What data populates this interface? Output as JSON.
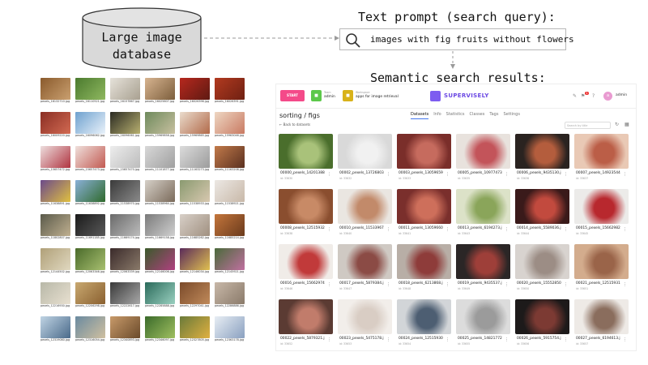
{
  "database": {
    "line1": "Large image",
    "line2": "database"
  },
  "prompt": {
    "title": "Text prompt (search query):",
    "query": "images with fig fruits without flowers"
  },
  "results_title": "Semantic search results:",
  "app": {
    "start": "START",
    "team_label": "Team",
    "team_name": "admin",
    "workspace_label": "Workspace",
    "workspace_name": "apps for image retrieval",
    "logo": "SUPERVISELY",
    "user": "admin",
    "user_initial": "a",
    "notification_count": "1",
    "breadcrumb": "sorting / figs",
    "back": "← Back to datasets",
    "tabs": [
      "Datasets",
      "Info",
      "Statistics",
      "Classes",
      "Tags",
      "Settings"
    ],
    "filter_placeholder": "Search by title",
    "cards": [
      {
        "name": "00000_pexels_14201388",
        "id": "id: 33630",
        "colors": [
          "#4a6e2c",
          "#a9c27a"
        ]
      },
      {
        "name": "00002_pexels_13726803",
        "id": "id: 33632",
        "colors": [
          "#d9d9d9",
          "#f1f1f1"
        ]
      },
      {
        "name": "00003_pexels_13059659",
        "id": "id: 33633",
        "colors": [
          "#7a2e2a",
          "#c66b5e"
        ]
      },
      {
        "name": "00005_pexels_10977473",
        "id": "id: 33635",
        "colors": [
          "#e8e2dd",
          "#c3545a"
        ]
      },
      {
        "name": "00006_pexels_9435130.j",
        "id": "id: 33636",
        "colors": [
          "#2a2320",
          "#b45d3d"
        ]
      },
      {
        "name": "00007_pexels_14923544",
        "id": "id: 33637",
        "colors": [
          "#e9c9b5",
          "#bb5e47"
        ]
      },
      {
        "name": "00008_pexels_12515932",
        "id": "id: 33638",
        "colors": [
          "#8a4e2f",
          "#c88a66"
        ]
      },
      {
        "name": "00010_pexels_11533967",
        "id": "id: 33640",
        "colors": [
          "#eae6e1",
          "#c28a6a"
        ]
      },
      {
        "name": "00011_pexels_13059660",
        "id": "id: 33641",
        "colors": [
          "#7a2f2c",
          "#ce6f5b"
        ]
      },
      {
        "name": "00013_pexels_6194273.j",
        "id": "id: 33643",
        "colors": [
          "#dce2c8",
          "#8aa55a"
        ]
      },
      {
        "name": "00014_pexels_5589036.j",
        "id": "id: 33644",
        "colors": [
          "#3a1a1a",
          "#c24a3e"
        ]
      },
      {
        "name": "00015_pexels_15662982",
        "id": "id: 33645",
        "colors": [
          "#ecebe9",
          "#b8282e"
        ]
      },
      {
        "name": "00016_pexels_15662974",
        "id": "id: 33646",
        "colors": [
          "#f0ece8",
          "#c13a3a"
        ]
      },
      {
        "name": "00017_pexels_5879384.j",
        "id": "id: 33647",
        "colors": [
          "#cfc9c3",
          "#8b4b45"
        ]
      },
      {
        "name": "00018_pexels_6213868.j",
        "id": "id: 33648",
        "colors": [
          "#b8aea6",
          "#8e3c3a"
        ]
      },
      {
        "name": "00019_pexels_9435537.j",
        "id": "id: 33649",
        "colors": [
          "#2b2626",
          "#9e3f39"
        ]
      },
      {
        "name": "00020_pexels_15552850",
        "id": "id: 33650",
        "colors": [
          "#d8d3cf",
          "#9c8d85"
        ]
      },
      {
        "name": "00021_pexels_12515931",
        "id": "id: 33651",
        "colors": [
          "#d3ac8d",
          "#9a6449"
        ]
      },
      {
        "name": "00022_pexels_5879321.j",
        "id": "id: 33652",
        "colors": [
          "#5b3b33",
          "#c17c6b"
        ]
      },
      {
        "name": "00023_pexels_5475178.j",
        "id": "id: 33653",
        "colors": [
          "#f2eeea",
          "#d9cdc4"
        ]
      },
      {
        "name": "00024_pexels_12515930",
        "id": "id: 33654",
        "colors": [
          "#d2d5d8",
          "#4d5e72"
        ]
      },
      {
        "name": "00025_pexels_14821772",
        "id": "id: 33655",
        "colors": [
          "#dcdcdc",
          "#9b9b9b"
        ]
      },
      {
        "name": "00026_pexels_5915754.j",
        "id": "id: 33656",
        "colors": [
          "#1d1a1a",
          "#7c3a33"
        ]
      },
      {
        "name": "00027_pexels_6194613.j",
        "id": "id: 33657",
        "colors": [
          "#eeeae6",
          "#8a6d5d"
        ]
      }
    ]
  },
  "left_grid": [
    {
      "cap": "pexels_16132710.jpg",
      "c": [
        "#8a5a2c",
        "#caa070"
      ]
    },
    {
      "cap": "pexels_16110521.jpg",
      "c": [
        "#4b7a2e",
        "#8fb860"
      ]
    },
    {
      "cap": "pexels_16157867.jpg",
      "c": [
        "#e6e2da",
        "#a8a090"
      ]
    },
    {
      "cap": "pexels_16025607.jpg",
      "c": [
        "#d7b490",
        "#7c5e3c"
      ]
    },
    {
      "cap": "pexels_16026396.jpg",
      "c": [
        "#b6281e",
        "#5e1a12"
      ]
    },
    {
      "cap": "pexels_16026391.jpg",
      "c": [
        "#b23a20",
        "#6e2012"
      ]
    },
    {
      "cap": "pexels_16009220.jpg",
      "c": [
        "#8a2e24",
        "#d26a52"
      ]
    },
    {
      "cap": "pexels_16096062.jpg",
      "c": [
        "#6ea1cf",
        "#eaf2fa"
      ]
    },
    {
      "cap": "pexels_16096061.jpg",
      "c": [
        "#2a2a22",
        "#b8b070"
      ]
    },
    {
      "cap": "pexels_15969858.jpg",
      "c": [
        "#6e8a5c",
        "#c8c0a0"
      ]
    },
    {
      "cap": "pexels_15969865.jpg",
      "c": [
        "#eadccd",
        "#b26a4a"
      ]
    },
    {
      "cap": "pexels_15963046.jpg",
      "c": [
        "#eed7c3",
        "#c97a62"
      ]
    },
    {
      "cap": "pexels_15657472.jpg",
      "c": [
        "#eddede",
        "#b03440"
      ]
    },
    {
      "cap": "pexels_15657473.jpg",
      "c": [
        "#efe0dc",
        "#c25a52"
      ]
    },
    {
      "cap": "pexels_15657470.jpg",
      "c": [
        "#ededed",
        "#bcbcbc"
      ]
    },
    {
      "cap": "pexels_11101877.jpg",
      "c": [
        "#d8d8d8",
        "#a0a0a0"
      ]
    },
    {
      "cap": "pexels_11163273.jpg",
      "c": [
        "#dcdcdc",
        "#9c9c9c"
      ]
    },
    {
      "cap": "pexels_11163208.jpg",
      "c": [
        "#c27a4a",
        "#5a3020"
      ]
    },
    {
      "cap": "pexels_11638891.jpg",
      "c": [
        "#6c4a8a",
        "#e0c040"
      ]
    },
    {
      "cap": "pexels_11638892.jpg",
      "c": [
        "#8ab0d8",
        "#2f6a2c"
      ]
    },
    {
      "cap": "pexels_11538970.jpg",
      "c": [
        "#3a3a3a",
        "#8a8a8a"
      ]
    },
    {
      "cap": "pexels_11538964.jpg",
      "c": [
        "#d6d0c8",
        "#7a6a5a"
      ]
    },
    {
      "cap": "pexels_11538933.jpg",
      "c": [
        "#8a9a70",
        "#d8c8b0"
      ]
    },
    {
      "cap": "pexels_11538921.jpg",
      "c": [
        "#ece8e4",
        "#c8b8a8"
      ]
    },
    {
      "cap": "pexels_11802807.jpg",
      "c": [
        "#5a5a4a",
        "#c0b090"
      ]
    },
    {
      "cap": "pexels_11691185.jpg",
      "c": [
        "#1a1a1a",
        "#5a5a5a"
      ]
    },
    {
      "cap": "pexels_11669174.jpg",
      "c": [
        "#6a6a6a",
        "#bcbcbc"
      ]
    },
    {
      "cap": "pexels_11669158.jpg",
      "c": [
        "#7a7a7a",
        "#d0d0d0"
      ]
    },
    {
      "cap": "pexels_11685262.jpg",
      "c": [
        "#d8d0c8",
        "#a09080"
      ]
    },
    {
      "cap": "pexels_11685214.jpg",
      "c": [
        "#c4763c",
        "#6a3a1c"
      ]
    },
    {
      "cap": "pexels_12144502.jpg",
      "c": [
        "#b0a078",
        "#e0d8c0"
      ]
    },
    {
      "cap": "pexels_12063346.jpg",
      "c": [
        "#4a6a2a",
        "#a8c070"
      ]
    },
    {
      "cap": "pexels_12063339.jpg",
      "c": [
        "#3a2a2a",
        "#8a7a6a"
      ]
    },
    {
      "cap": "pexels_12146006.jpg",
      "c": [
        "#3a5a2a",
        "#b04080"
      ]
    },
    {
      "cap": "pexels_12146034.jpg",
      "c": [
        "#5a2a5a",
        "#e0c050"
      ]
    },
    {
      "cap": "pexels_12145921.jpg",
      "c": [
        "#4a6a3a",
        "#c070a0"
      ]
    },
    {
      "cap": "pexels_12216930.jpg",
      "c": [
        "#b8b8a8",
        "#e8e0d0"
      ]
    },
    {
      "cap": "pexels_12206298.jpg",
      "c": [
        "#c8a870",
        "#8a6030"
      ]
    },
    {
      "cap": "pexels_12222617.jpg",
      "c": [
        "#3a3a3a",
        "#a8a8a8"
      ]
    },
    {
      "cap": "pexels_12285888.jpg",
      "c": [
        "#2a6a5a",
        "#9ad0c0"
      ]
    },
    {
      "cap": "pexels_12297041.jpg",
      "c": [
        "#7a4a2a",
        "#c08a5a"
      ]
    },
    {
      "cap": "pexels_12286886.jpg",
      "c": [
        "#c8b8a8",
        "#8a7a6a"
      ]
    },
    {
      "cap": "pexels_12319080.jpg",
      "c": [
        "#c0d4e4",
        "#4a6a8a"
      ]
    },
    {
      "cap": "pexels_12316054.jpg",
      "c": [
        "#6a8aa0",
        "#d0c0a0"
      ]
    },
    {
      "cap": "pexels_12340893.jpg",
      "c": [
        "#c89a6a",
        "#6a4a2a"
      ]
    },
    {
      "cap": "pexels_12346097.jpg",
      "c": [
        "#3a6a2a",
        "#a0c060"
      ]
    },
    {
      "cap": "pexels_12327805.jpg",
      "c": [
        "#6a7a3a",
        "#e0b040"
      ]
    },
    {
      "cap": "pexels_12363178.jpg",
      "c": [
        "#e8eef4",
        "#8aa0c0"
      ]
    }
  ]
}
